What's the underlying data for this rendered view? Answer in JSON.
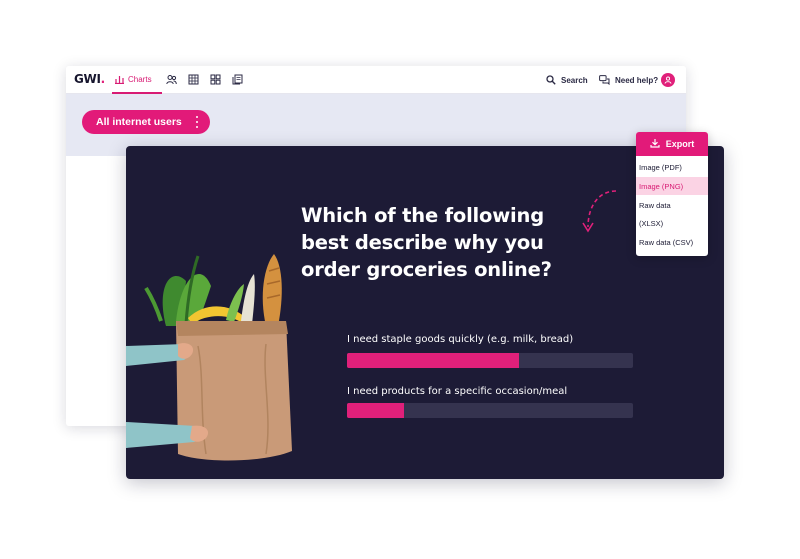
{
  "app": {
    "logo_text": "GWI",
    "nav": {
      "charts_label": "Charts",
      "icons": [
        "audiences-icon",
        "table-icon",
        "dashboard-icon",
        "reports-icon"
      ]
    },
    "search_label": "Search",
    "help_label": "Need help?",
    "audience_label": "All internet users"
  },
  "chart": {
    "question_lines": [
      "Which of the following",
      "best describe why you",
      "order groceries online?"
    ],
    "items": [
      {
        "label": "I need staple goods quickly (e.g. milk, bread)",
        "value": 0.6
      },
      {
        "label": "I need products for a specific occasion/meal",
        "value": 0.2
      }
    ]
  },
  "export_menu": {
    "button_label": "Export",
    "items": [
      {
        "label": "Image (PDF)",
        "active": false
      },
      {
        "label": "Image (PNG)",
        "active": true
      },
      {
        "label": "Raw data",
        "active": false
      },
      {
        "label": "(XLSX)",
        "active": false
      },
      {
        "label": "Raw data (CSV)",
        "active": false
      }
    ]
  },
  "colors": {
    "accent": "#e21a79",
    "chart_bg": "#1d1b36",
    "track": "#35334f",
    "audience_strip": "#e6e8f3"
  }
}
